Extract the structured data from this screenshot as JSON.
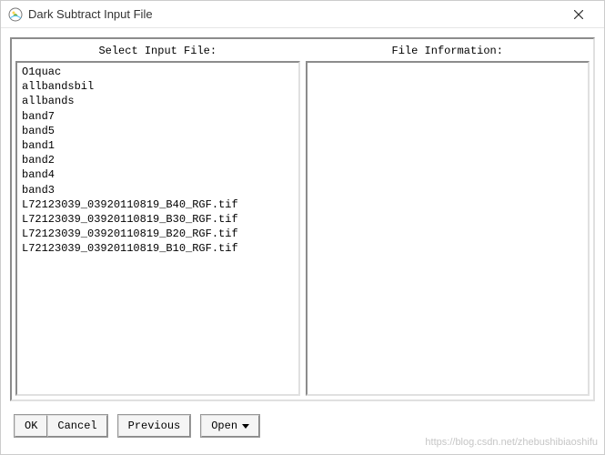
{
  "window": {
    "title": "Dark Subtract Input File"
  },
  "panels": {
    "left_header": "Select Input File:",
    "right_header": "File Information:"
  },
  "files": [
    "O1quac",
    "allbandsbil",
    "allbands",
    "band7",
    "band5",
    "band1",
    "band2",
    "band4",
    "band3",
    "L72123039_03920110819_B40_RGF.tif",
    "L72123039_03920110819_B30_RGF.tif",
    "L72123039_03920110819_B20_RGF.tif",
    "L72123039_03920110819_B10_RGF.tif"
  ],
  "buttons": {
    "ok": "OK",
    "cancel": "Cancel",
    "previous": "Previous",
    "open": "Open"
  },
  "watermark": "https://blog.csdn.net/zhebushibiaoshifu"
}
